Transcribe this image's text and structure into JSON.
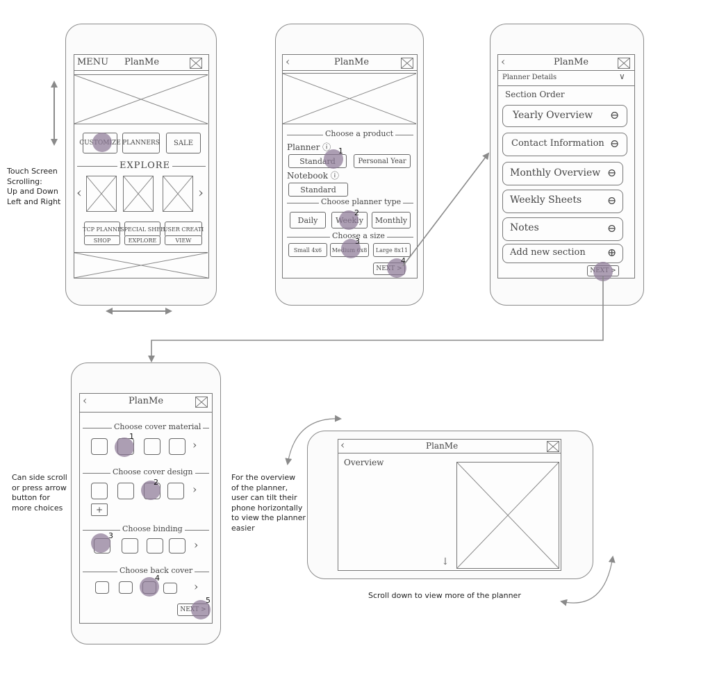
{
  "app_title": "PlanMe",
  "screen1": {
    "menu": "MENU",
    "title": "PlanMe",
    "buttons": [
      "CUSTOMIZE",
      "PLANNERS",
      "SALE"
    ],
    "explore": "EXPLORE",
    "cards": [
      {
        "label": "TCP PLANNE",
        "action": "SHOP"
      },
      {
        "label": "SPECIAL SHEE",
        "action": "EXPLORE"
      },
      {
        "label": "USER CREATI",
        "action": "VIEW"
      }
    ]
  },
  "screen2": {
    "title": "PlanMe",
    "choose_product": "Choose a product",
    "planner_label": "Planner ⓘ",
    "planner_options": [
      "Standard",
      "Personal Year"
    ],
    "notebook_label": "Notebook ⓘ",
    "notebook_options": [
      "Standard"
    ],
    "choose_type": "Choose planner type",
    "type_options": [
      "Daily",
      "Weekly",
      "Monthly"
    ],
    "choose_size": "Choose a size",
    "size_options": [
      "Small 4x6",
      "Medium 6x8",
      "Large 8x11"
    ],
    "next": "NEXT >"
  },
  "screen3": {
    "title": "PlanMe",
    "dropdown": "Planner Details",
    "section_heading": "Section Order",
    "sections": [
      "Yearly Overview",
      "Contact Information",
      "Monthly Overview",
      "Weekly Sheets",
      "Notes"
    ],
    "add_section": "Add new section",
    "next": "NEXT >"
  },
  "screen4": {
    "title": "PlanMe",
    "groups": [
      "Choose cover material",
      "Choose cover design",
      "Choose binding",
      "Choose back cover"
    ],
    "next": "NEXT >"
  },
  "screen5": {
    "title": "PlanMe",
    "overview": "Overview"
  },
  "step_numbers": {
    "s2": [
      "1",
      "2",
      "3",
      "4"
    ],
    "s4": [
      "1",
      "2",
      "3",
      "4",
      "5"
    ]
  },
  "notes": {
    "scrolling": [
      "Touch Screen",
      "Scrolling:",
      "Up and Down",
      "Left and Right"
    ],
    "side_scroll": [
      "Can side scroll",
      "or press arrow",
      "button for",
      "more choices"
    ],
    "tilt": [
      "For the overview",
      "of the planner,",
      "user can tilt their",
      "phone horizontally",
      "to view the planner",
      "easier"
    ],
    "scroll_down": "Scroll down to view more of the planner"
  },
  "colors": {
    "highlight": "#8c7896",
    "sketch_line": "#777777",
    "arrow": "#8a8a8a"
  }
}
